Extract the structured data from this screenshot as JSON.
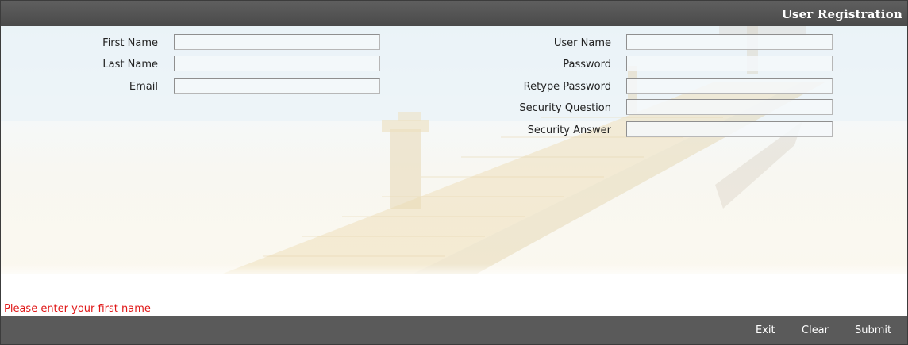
{
  "window": {
    "title": "User Registration"
  },
  "form": {
    "left_fields": [
      {
        "label": "First Name",
        "value": ""
      },
      {
        "label": "Last Name",
        "value": ""
      },
      {
        "label": "Email",
        "value": ""
      }
    ],
    "right_fields": [
      {
        "label": "User Name",
        "value": ""
      },
      {
        "label": "Password",
        "value": ""
      },
      {
        "label": "Retype Password",
        "value": ""
      },
      {
        "label": "Security Question",
        "value": ""
      },
      {
        "label": "Security Answer",
        "value": ""
      }
    ]
  },
  "validation": {
    "message": "Please enter your first name",
    "color": "#e01818"
  },
  "footer": {
    "buttons": [
      "Exit",
      "Clear",
      "Submit"
    ]
  },
  "colors": {
    "titlebar": "#4f4f4f",
    "footer": "#5a5a5a"
  }
}
